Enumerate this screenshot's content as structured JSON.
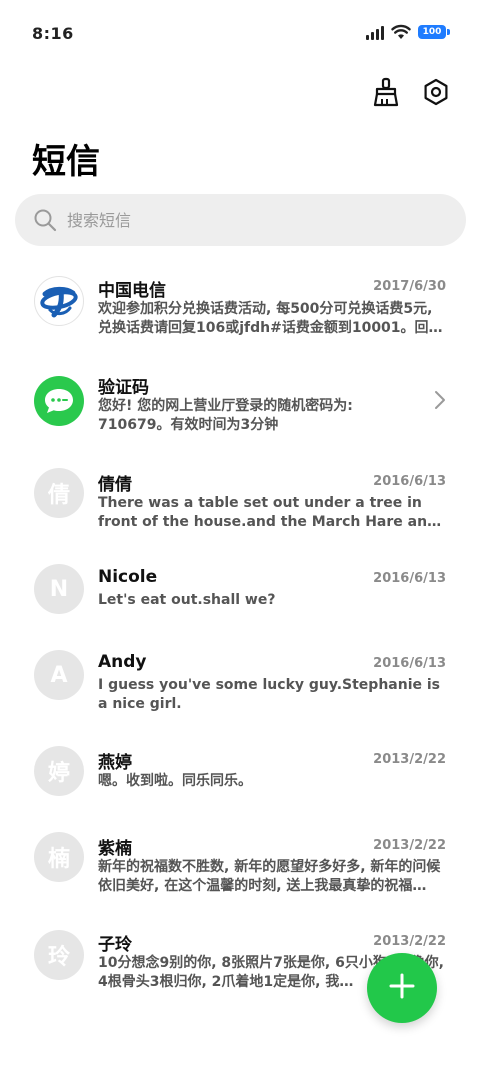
{
  "status_bar": {
    "time": "8:16",
    "battery_level": "100",
    "battery_color": "#1f7cff"
  },
  "header": {
    "title": "短信",
    "actions": [
      {
        "icon": "broom-icon"
      },
      {
        "icon": "gear-icon"
      }
    ]
  },
  "search": {
    "placeholder": "搜索短信",
    "icon": "search-icon"
  },
  "messages": [
    {
      "sender": "中国电信",
      "date": "2017/6/30",
      "preview": "欢迎参加积分兑换话费活动, 每500分可兑换话费5元, 兑换话费请回复106或jfdh#话费金额到10001。回复…",
      "avatar_type": "logo",
      "avatar_icon": "china-telecom-logo-icon"
    },
    {
      "sender": "验证码",
      "date": "",
      "preview": "您好! 您的网上营业厅登录的随机密码为: 710679。有效时间为3分钟",
      "avatar_type": "icon",
      "avatar_icon": "chat-bubble-icon",
      "has_chevron": true
    },
    {
      "sender": "倩倩",
      "date": "2016/6/13",
      "preview": "There was a table set out under a tree in front of the house.and the March Hare and the Ha…",
      "avatar_letter": "倩"
    },
    {
      "sender": "Nicole",
      "date": "2016/6/13",
      "preview": "Let's eat out.shall we?",
      "avatar_letter": "N"
    },
    {
      "sender": "Andy",
      "date": "2016/6/13",
      "preview": "I guess you've some lucky guy.Stephanie is a nice girl.",
      "avatar_letter": "A"
    },
    {
      "sender": "燕婷",
      "date": "2013/2/22",
      "preview": "嗯。收到啦。同乐同乐。",
      "avatar_letter": "婷"
    },
    {
      "sender": "紫楠",
      "date": "2013/2/22",
      "preview": "新年的祝福数不胜数, 新年的愿望好多好多, 新年的问候依旧美好, 在这个温馨的时刻, 送上我最真挚的祝福…",
      "avatar_letter": "楠"
    },
    {
      "sender": "子玲",
      "date": "2013/2/22",
      "preview": "10分想念9别的你, 8张照片7张是你, 6只小狗5只像你, 4根骨头3根归你, 2爪着地1定是你, 我…",
      "avatar_letter": "玲"
    }
  ],
  "fab": {
    "icon": "plus-icon",
    "color": "#22c84a"
  }
}
